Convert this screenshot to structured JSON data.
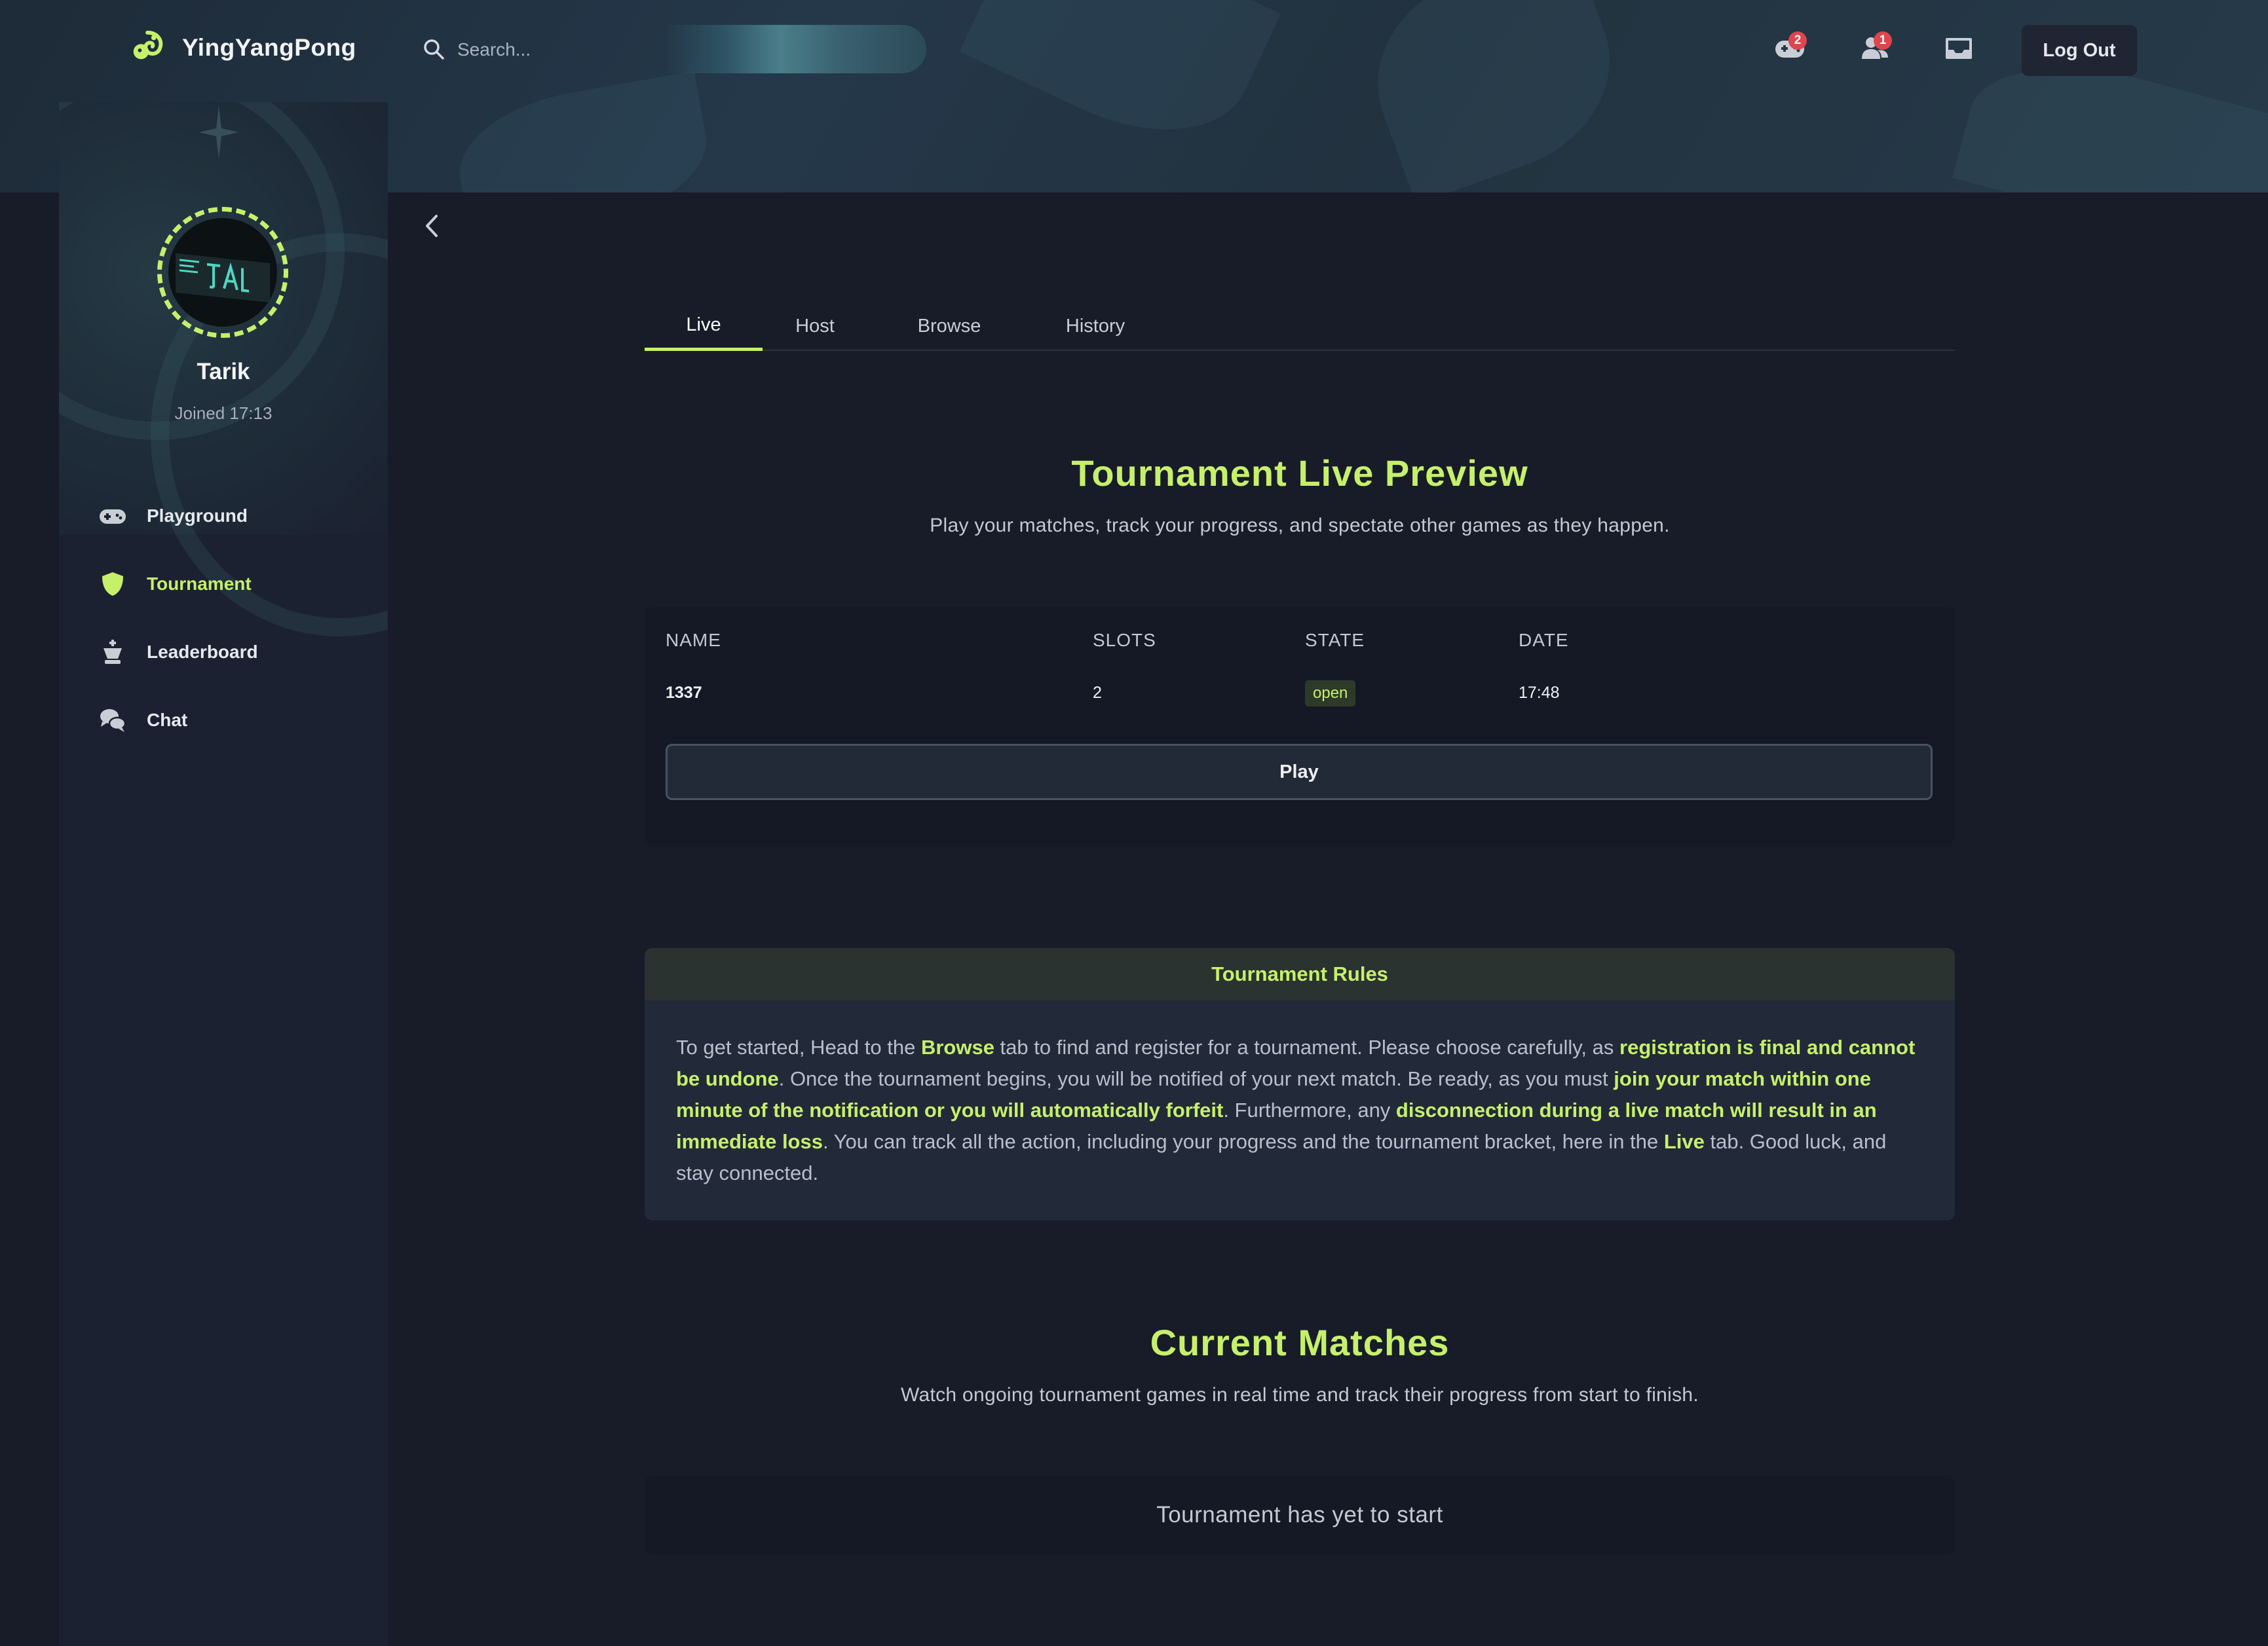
{
  "brand": {
    "name": "YingYangPong",
    "logo_icon": "yingyang-logo-icon"
  },
  "search": {
    "placeholder": "Search..."
  },
  "header": {
    "game_notifications_count": "2",
    "friend_requests_count": "1",
    "logout_label": "Log Out"
  },
  "user": {
    "name": "Tarik",
    "joined": "Joined 17:13"
  },
  "sidebar": {
    "items": [
      {
        "label": "Playground",
        "icon": "gamepad-icon"
      },
      {
        "label": "Tournament",
        "icon": "shield-icon",
        "active": true
      },
      {
        "label": "Leaderboard",
        "icon": "chess-king-icon"
      },
      {
        "label": "Chat",
        "icon": "chat-bubbles-icon"
      }
    ]
  },
  "tabs": [
    {
      "label": "Live",
      "active": true
    },
    {
      "label": "Host"
    },
    {
      "label": "Browse"
    },
    {
      "label": "History"
    }
  ],
  "live_preview": {
    "title": "Tournament Live Preview",
    "subtitle": "Play your matches, track your progress, and spectate other games as they happen."
  },
  "table": {
    "headers": [
      "NAME",
      "SLOTS",
      "STATE",
      "DATE"
    ],
    "row": {
      "name": "1337",
      "slots": "2",
      "state": "open",
      "date": "17:48"
    },
    "play_label": "Play"
  },
  "rules": {
    "title": "Tournament Rules",
    "p1": "To get started, Head to the ",
    "b1": "Browse",
    "p2": " tab to find and register for a tournament. Please choose carefully, as ",
    "b2": "registration is final and cannot be undone",
    "p3": ". Once the tournament begins, you will be notified of your next match. Be ready, as you must ",
    "b3": "join your match within one minute of the notification or you will automatically forfeit",
    "p4": ". Furthermore, any ",
    "b4": "disconnection during a live match will result in an immediate loss",
    "p5": ". You can track all the action, including your progress and the tournament bracket, here in the ",
    "b5": "Live",
    "p6": " tab. Good luck, and stay connected."
  },
  "matches": {
    "title": "Current Matches",
    "subtitle": "Watch ongoing tournament games in real time and track their progress from start to finish.",
    "empty": "Tournament has yet to start"
  },
  "colors": {
    "accent": "#c6f06a",
    "background": "#171c28",
    "badge": "#e0454d"
  }
}
